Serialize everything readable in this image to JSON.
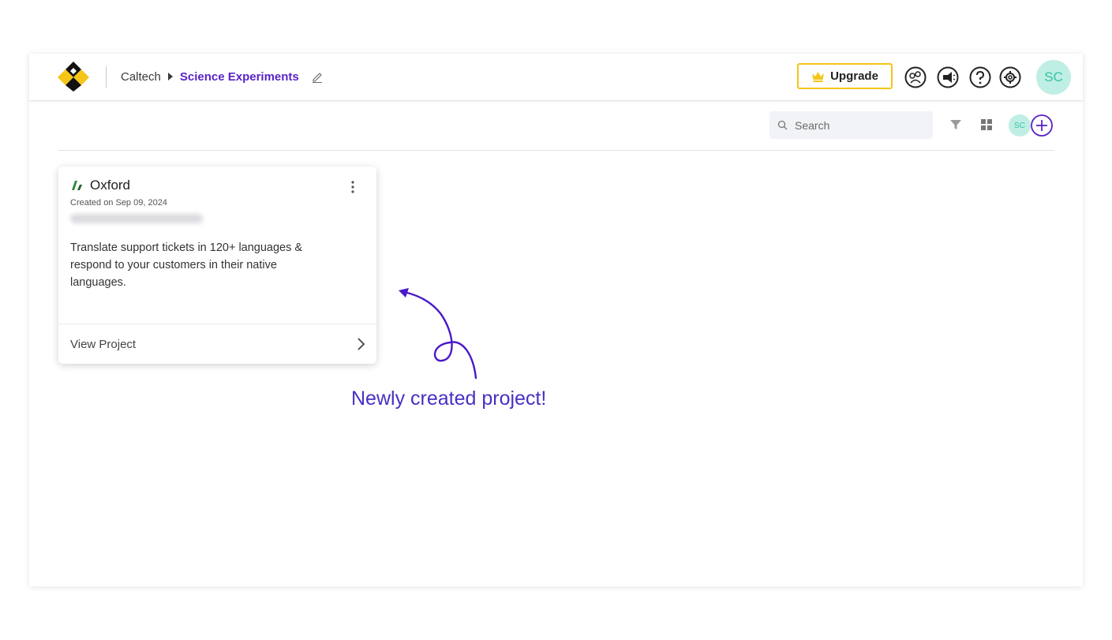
{
  "header": {
    "org": "Caltech",
    "project": "Science Experiments",
    "upgrade_label": "Upgrade",
    "avatar_initials": "SC",
    "icons": [
      "community-icon",
      "announcement-icon",
      "help-icon",
      "settings-icon"
    ]
  },
  "toolbar": {
    "search_placeholder": "Search",
    "avatar_initials": "SC"
  },
  "card": {
    "title": "Oxford",
    "created": "Created on Sep 09, 2024",
    "description": "Translate support tickets in 120+ languages & respond to your customers in their native languages.",
    "footer_label": "View Project"
  },
  "annotation": {
    "text": "Newly created project!"
  },
  "colors": {
    "accent": "#5a23c8",
    "upgrade_border": "#f5c518",
    "avatar_bg": "#bfeee4",
    "avatar_text": "#35c3a4",
    "annotation": "#4a2fc4"
  }
}
